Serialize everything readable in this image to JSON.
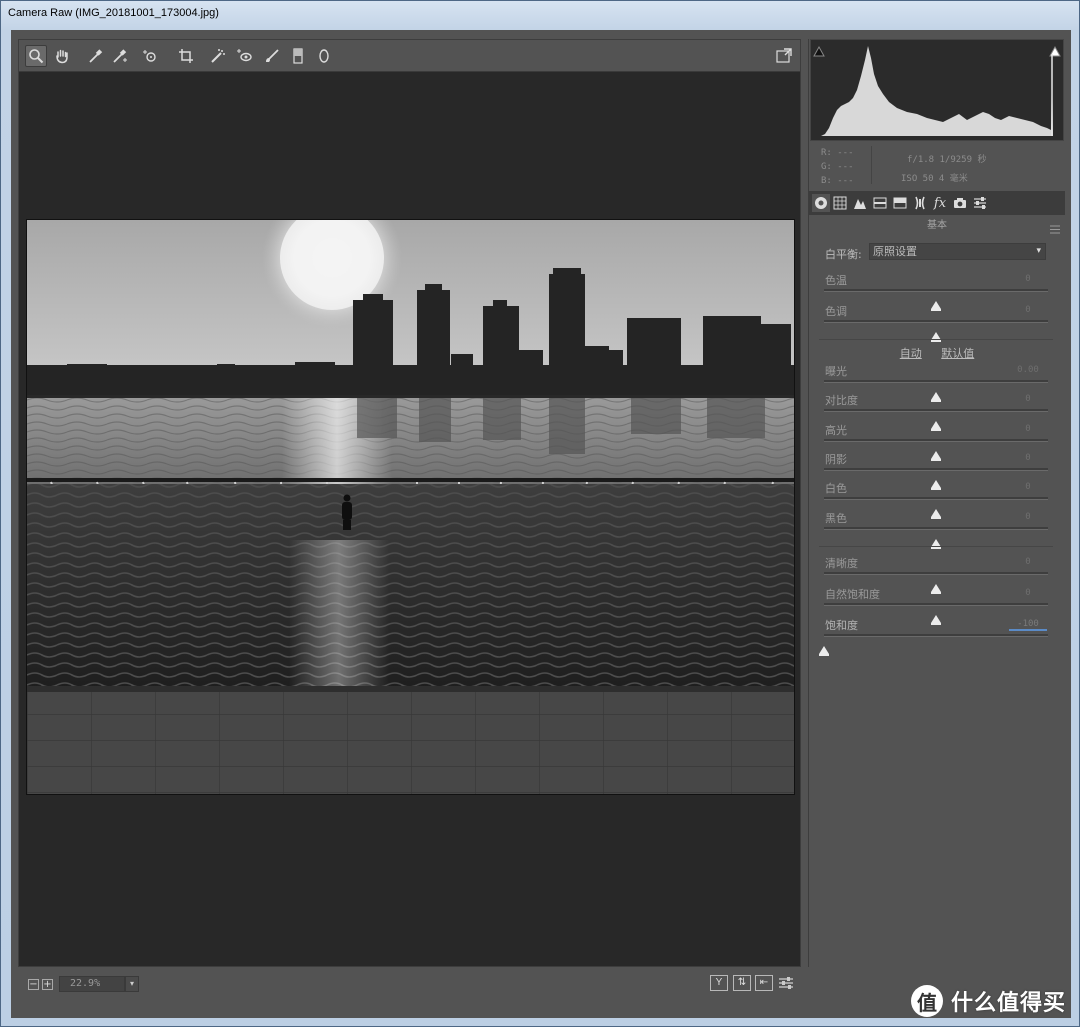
{
  "window": {
    "title": "Camera Raw (IMG_20181001_173004.jpg)"
  },
  "toolbar": {
    "tools": [
      "zoom-icon",
      "hand-icon",
      "white-balance-icon",
      "color-sampler-icon",
      "targeted-adjustment-icon",
      "crop-icon",
      "spot-removal-icon",
      "red-eye-icon",
      "adjustment-brush-icon",
      "graduated-filter-icon",
      "radial-filter-icon"
    ],
    "fullscreen": "fullscreen-icon"
  },
  "status": {
    "zoom_out": "−",
    "zoom_in": "+",
    "zoom_level": "22.9%",
    "view_y": "Y"
  },
  "info": {
    "r": "R:  ---",
    "g": "G:  ---",
    "b": "B:  ---",
    "exposure": "f/1.8  1/9259 秒",
    "iso": "ISO 50  4 毫米"
  },
  "panel": {
    "section_title": "基本",
    "white_balance_label": "白平衡:",
    "white_balance_value": "原照设置",
    "auto": "自动",
    "default": "默认值",
    "sliders": [
      {
        "label": "色温",
        "value": "0",
        "pos": 0.5
      },
      {
        "label": "色调",
        "value": "0",
        "pos": 0.5
      },
      {
        "label": "曝光",
        "value": "0.00",
        "pos": 0.5
      },
      {
        "label": "对比度",
        "value": "0",
        "pos": 0.5
      },
      {
        "label": "高光",
        "value": "0",
        "pos": 0.5
      },
      {
        "label": "阴影",
        "value": "0",
        "pos": 0.5
      },
      {
        "label": "白色",
        "value": "0",
        "pos": 0.5
      },
      {
        "label": "黑色",
        "value": "0",
        "pos": 0.5
      },
      {
        "label": "清晰度",
        "value": "0",
        "pos": 0.5
      },
      {
        "label": "自然饱和度",
        "value": "0",
        "pos": 0.5
      },
      {
        "label": "饱和度",
        "value": "-100",
        "pos": 0.0
      }
    ]
  },
  "watermark": {
    "logo": "值",
    "text": "什么值得买"
  }
}
